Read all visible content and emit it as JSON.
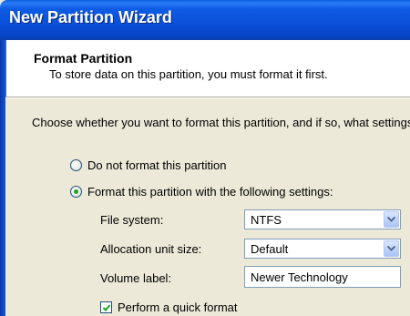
{
  "window": {
    "title": "New Partition Wizard"
  },
  "header": {
    "title": "Format Partition",
    "subtitle": "To store data on this partition, you must format it first."
  },
  "main": {
    "prompt": "Choose whether you want to format this partition, and if so, what settings",
    "option_no_format": {
      "label": "Do not format this partition",
      "checked": false
    },
    "option_format": {
      "label": "Format this partition with the following settings:",
      "checked": true
    },
    "file_system": {
      "label": "File system:",
      "value": "NTFS"
    },
    "allocation_unit": {
      "label": "Allocation unit size:",
      "value": "Default"
    },
    "volume_label": {
      "label": "Volume label:",
      "value": "Newer Technology"
    },
    "quick_format": {
      "label": "Perform a quick format",
      "checked": true
    }
  },
  "colors": {
    "titlebar": "#0a4fd8",
    "dialog_bg": "#ece9d8",
    "checkmark": "#21a121"
  }
}
